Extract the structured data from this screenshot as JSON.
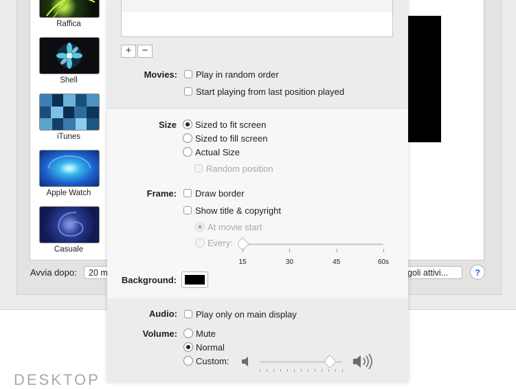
{
  "sidebar": {
    "items": [
      {
        "label": "Raffica"
      },
      {
        "label": "Shell"
      },
      {
        "label": "iTunes"
      },
      {
        "label": "Apple Watch"
      },
      {
        "label": "Casuale"
      }
    ]
  },
  "footer": {
    "start_after_label": "Avvia dopo:",
    "start_after_value": "20 m",
    "hot_corners_label": "goli attivi...",
    "help_label": "?"
  },
  "watermark": {
    "text": "DESKTOP"
  },
  "options": {
    "playlist": {
      "add_label": "+",
      "remove_label": "−"
    },
    "movies": {
      "label": "Movies:",
      "random_order": {
        "label": "Play in random order",
        "checked": false
      },
      "resume": {
        "label": "Start playing from last position played",
        "checked": false
      }
    },
    "size": {
      "label": "Size",
      "fit": {
        "label": "Sized to fit screen",
        "selected": true
      },
      "fill": {
        "label": "Sized to fill screen",
        "selected": false
      },
      "actual": {
        "label": "Actual Size",
        "selected": false
      },
      "random_position": {
        "label": "Random position",
        "checked": false
      }
    },
    "frame": {
      "label": "Frame:",
      "draw_border": {
        "label": "Draw border",
        "checked": false
      },
      "show_title": {
        "label": "Show title & copyright",
        "checked": false
      },
      "at_start": {
        "label": "At movie start",
        "selected": true
      },
      "every": {
        "label": "Every:",
        "selected": false
      },
      "every_ticks": [
        "15",
        "30",
        "45",
        "60s"
      ],
      "every_value": 15
    },
    "background": {
      "label": "Background:",
      "color": "#000000"
    },
    "audio": {
      "label": "Audio:",
      "main_display": {
        "label": "Play only on main display",
        "checked": false
      }
    },
    "volume": {
      "label": "Volume:",
      "mute": {
        "label": "Mute",
        "selected": false
      },
      "normal": {
        "label": "Normal",
        "selected": true
      },
      "custom": {
        "label": "Custom:",
        "selected": false
      },
      "level_fraction": 0.85
    }
  }
}
